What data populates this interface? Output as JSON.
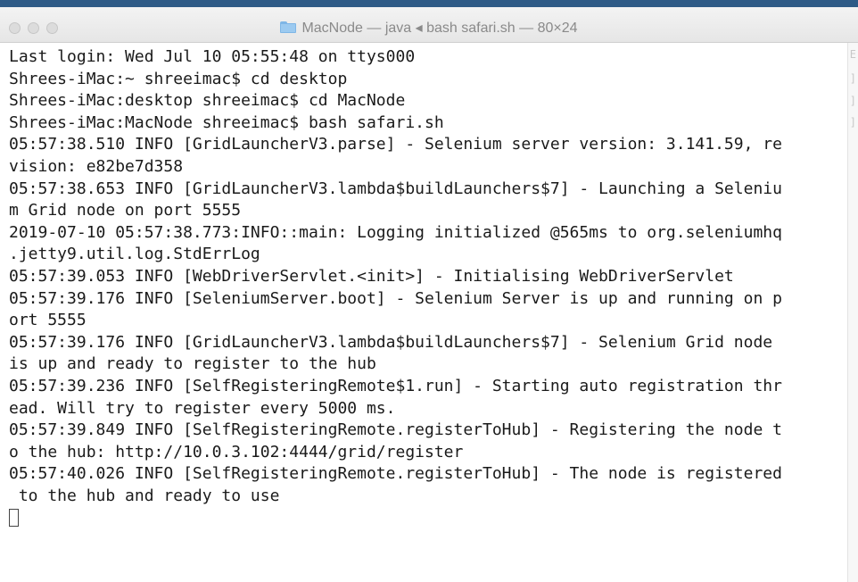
{
  "window": {
    "title": "MacNode — java ◂ bash safari.sh — 80×24"
  },
  "terminal": {
    "lines": [
      "Last login: Wed Jul 10 05:55:48 on ttys000",
      "Shrees-iMac:~ shreeimac$ cd desktop",
      "Shrees-iMac:desktop shreeimac$ cd MacNode",
      "Shrees-iMac:MacNode shreeimac$ bash safari.sh",
      "05:57:38.510 INFO [GridLauncherV3.parse] - Selenium server version: 3.141.59, re",
      "vision: e82be7d358",
      "05:57:38.653 INFO [GridLauncherV3.lambda$buildLaunchers$7] - Launching a Seleniu",
      "m Grid node on port 5555",
      "2019-07-10 05:57:38.773:INFO::main: Logging initialized @565ms to org.seleniumhq",
      ".jetty9.util.log.StdErrLog",
      "05:57:39.053 INFO [WebDriverServlet.<init>] - Initialising WebDriverServlet",
      "05:57:39.176 INFO [SeleniumServer.boot] - Selenium Server is up and running on p",
      "ort 5555",
      "05:57:39.176 INFO [GridLauncherV3.lambda$buildLaunchers$7] - Selenium Grid node",
      "is up and ready to register to the hub",
      "05:57:39.236 INFO [SelfRegisteringRemote$1.run] - Starting auto registration thr",
      "ead. Will try to register every 5000 ms.",
      "05:57:39.849 INFO [SelfRegisteringRemote.registerToHub] - Registering the node t",
      "o the hub: http://10.0.3.102:4444/grid/register",
      "05:57:40.026 INFO [SelfRegisteringRemote.registerToHub] - The node is registered",
      " to the hub and ready to use"
    ]
  },
  "icons": {
    "title_icon": "folder-icon",
    "window_controls": [
      "close-button",
      "minimize-button",
      "zoom-button"
    ]
  },
  "colors": {
    "terminal_background": "#ffffff",
    "terminal_text": "#1a1a1a",
    "title_text": "#8a8a8a",
    "folder": "#9ccaf0"
  }
}
